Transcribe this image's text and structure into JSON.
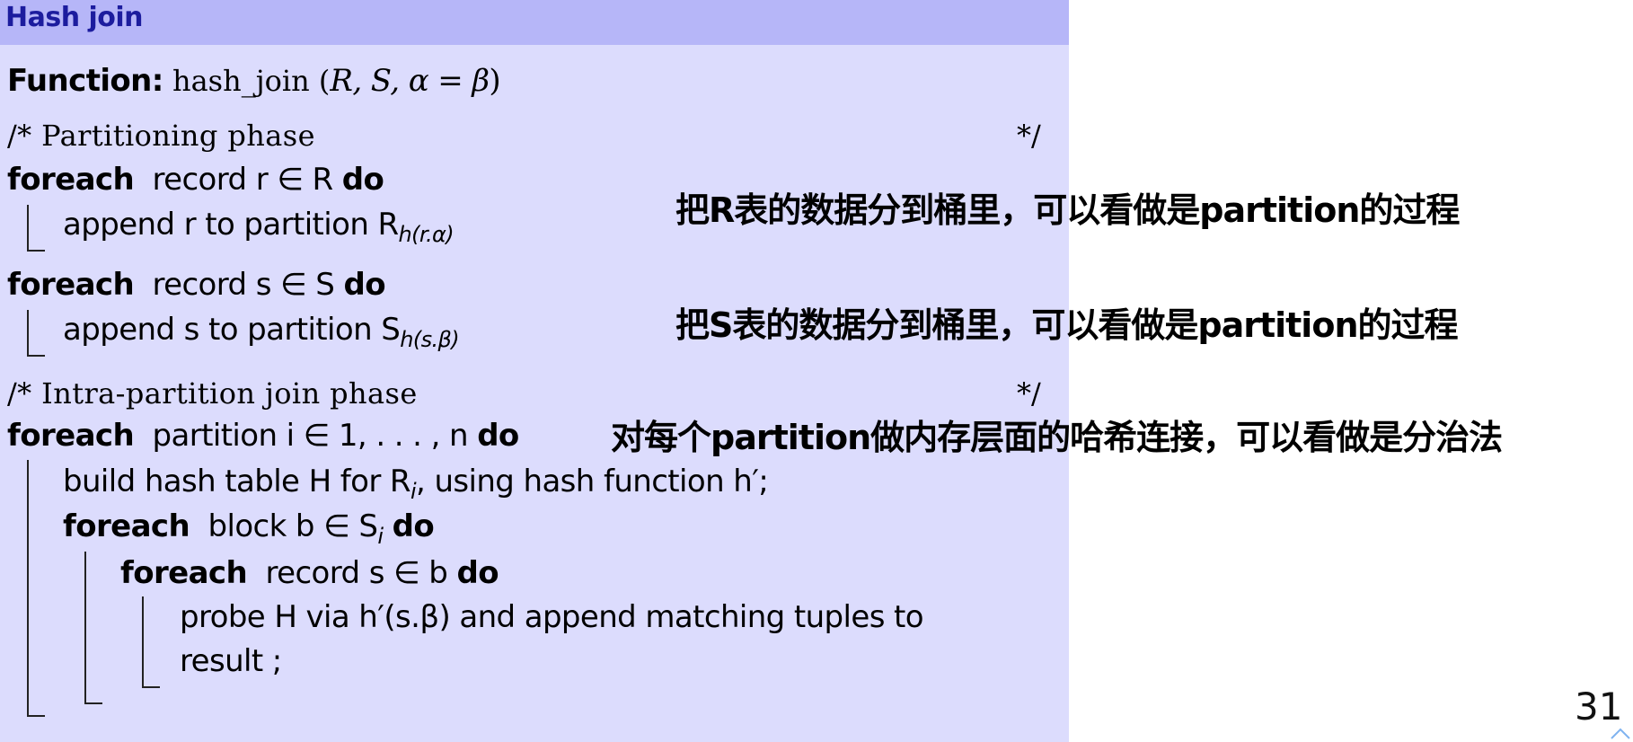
{
  "header": {
    "title": "Hash join"
  },
  "algorithm": {
    "function_label": "Function:",
    "function_signature": "hash_join (",
    "function_params": "R, S, α = β",
    "function_close": ")",
    "comment_partition": "/* Partitioning phase",
    "comment_end_1": "*/",
    "foreach_r": {
      "kw": "foreach",
      "text": "record r ∈ R",
      "do": "do"
    },
    "append_r": {
      "text": "append r to partition R",
      "sub": "h(r.α)"
    },
    "foreach_s": {
      "kw": "foreach",
      "text": "record s ∈ S",
      "do": "do"
    },
    "append_s": {
      "text": "append s to partition S",
      "sub": "h(s.β)"
    },
    "comment_intra": "/* Intra-partition join phase",
    "comment_end_2": "*/",
    "foreach_partition": {
      "kw": "foreach",
      "text": "partition i ∈ 1, . . . , n",
      "do": "do"
    },
    "build_line": {
      "pre": "build hash table H for R",
      "sub": "i",
      "post": ", using hash function h′;"
    },
    "foreach_block": {
      "kw": "foreach",
      "pre": "block b ∈ S",
      "sub": "i",
      "do": "do"
    },
    "foreach_record_b": {
      "kw": "foreach",
      "text": "record s ∈ b",
      "do": "do"
    },
    "probe_line_1": "probe H via h′(s.β) and append matching tuples to",
    "probe_line_2": "result ;"
  },
  "annotations": {
    "r_partition": "把R表的数据分到桶里，可以看做是partition的过程",
    "s_partition": "把S表的数据分到桶里，可以看做是partition的过程",
    "intra_join": "对每个partition做内存层面的哈希连接，可以看做是分治法"
  },
  "page_number": "31",
  "colors": {
    "header_bg": "#b6b6f8",
    "panel_bg": "#dcdcfd",
    "title": "#1c1c9e"
  }
}
